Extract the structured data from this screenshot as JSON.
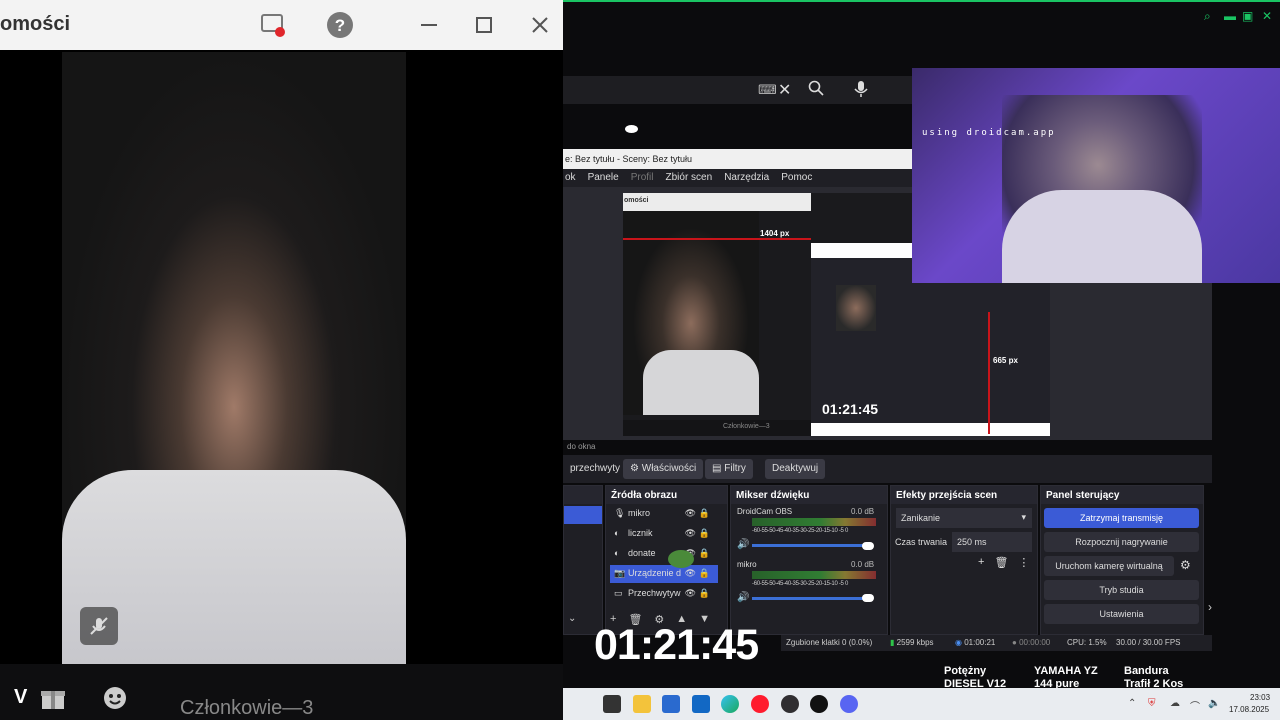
{
  "left_window": {
    "title": "omości",
    "members_label": "Członkowie—3",
    "bottom_letter": "V"
  },
  "obs": {
    "title": "e: Bez tytułu - Sceny: Bez tytułu",
    "menu": [
      "ok",
      "Panele",
      "Profil",
      "Zbiór scen",
      "Narzędzia",
      "Pomoc"
    ],
    "inner_window_title": "omości",
    "inner_px_label": "1404 px",
    "inner_px_label2": "665 px",
    "inner_timer": "01:21:45",
    "inner_members": "Członkowie—3",
    "do_okna": "do okna",
    "toolbar": {
      "capture": "przechwyty",
      "properties": "Właściwości",
      "filters": "Filtry",
      "deactivate": "Deaktywuj"
    },
    "sources_title": "Źródła obrazu",
    "sources": [
      {
        "icon": "mic-icon",
        "name": "mikro"
      },
      {
        "icon": "globe-icon",
        "name": "licznik"
      },
      {
        "icon": "globe-icon",
        "name": "donate"
      },
      {
        "icon": "camera-icon",
        "name": "Urządzenie d"
      },
      {
        "icon": "monitor-icon",
        "name": "Przechwytyw"
      }
    ],
    "mixer_title": "Mikser dźwięku",
    "mixer": [
      {
        "name": "DroidCam OBS",
        "db": "0.0 dB",
        "ticks": "-60-55-50-45-40-35-30-25-20-15-10 -5 0"
      },
      {
        "name": "mikro",
        "db": "0.0 dB",
        "ticks": "-60-55-50-45-40-35-30-25-20-15-10 -5 0"
      }
    ],
    "transitions_title": "Efekty przejścia scen",
    "transition_value": "Zanikanie",
    "duration_label": "Czas trwania",
    "duration_value": "250 ms",
    "controls_title": "Panel sterujący",
    "controls": [
      "Zatrzymaj transmisję",
      "Rozpocznij nagrywanie",
      "Uruchom kamerę wirtualną",
      "Tryb studia",
      "Ustawienia"
    ],
    "status": {
      "dropped": "Zgubione klatki 0 (0.0%)",
      "kbps": "2599 kbps",
      "live_time": "01:00:21",
      "rec_time": "00:00:00",
      "cpu": "CPU: 1.5%",
      "fps": "30.00 / 30.00 FPS"
    }
  },
  "big_timer": "01:21:45",
  "droidcam_text": "using droidcam.app",
  "news": [
    {
      "line1": "Potężny",
      "line2": "DIESEL V12"
    },
    {
      "line1": "YAMAHA YZ",
      "line2": "144 pure"
    },
    {
      "line1": "Bandura",
      "line2": "Trafił 2 Kos"
    }
  ],
  "taskbar": {
    "time": "23:03",
    "date": "17.08.2025"
  }
}
